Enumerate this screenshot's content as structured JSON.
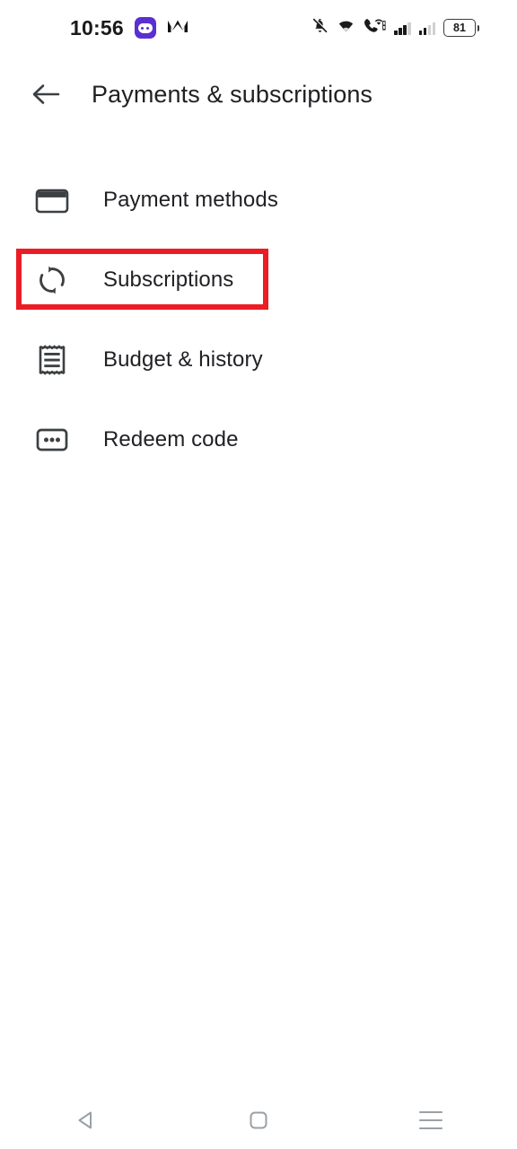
{
  "status_bar": {
    "clock": "10:56",
    "left_icons": [
      {
        "name": "discord-app-icon",
        "glyph": "app-badge"
      },
      {
        "name": "monzo-app-icon",
        "glyph": "M"
      }
    ],
    "right_icons": [
      {
        "name": "notifications-off-icon"
      },
      {
        "name": "wifi-icon"
      },
      {
        "name": "vowifi-call-icon"
      },
      {
        "name": "signal-bars-sim1-icon"
      },
      {
        "name": "signal-bars-sim2-icon"
      }
    ],
    "battery_level": "81"
  },
  "app_bar": {
    "back_label": "Back",
    "title": "Payments & subscriptions"
  },
  "list": {
    "items": [
      {
        "icon": "credit-card-icon",
        "label": "Payment methods"
      },
      {
        "icon": "autorenew-icon",
        "label": "Subscriptions"
      },
      {
        "icon": "receipt-icon",
        "label": "Budget & history"
      },
      {
        "icon": "redeem-code-icon",
        "label": "Redeem code"
      }
    ]
  },
  "annotation": {
    "target": "Subscriptions",
    "color": "#ec1c24"
  },
  "nav_bar": {
    "buttons": [
      {
        "name": "nav-back-button",
        "label": "Back"
      },
      {
        "name": "nav-home-button",
        "label": "Home"
      },
      {
        "name": "nav-recents-button",
        "label": "Recents"
      }
    ]
  }
}
